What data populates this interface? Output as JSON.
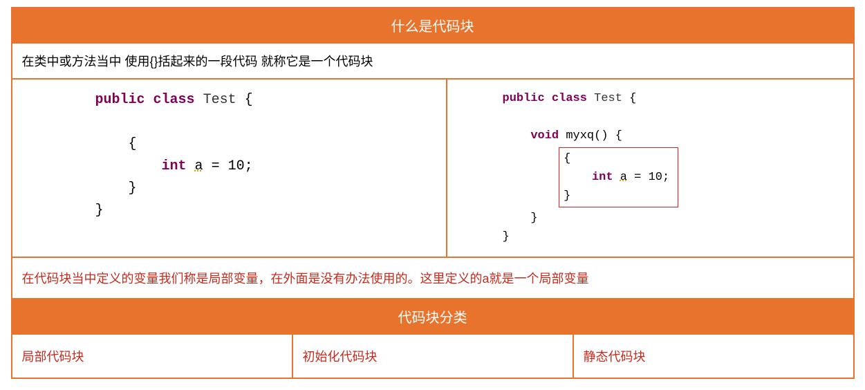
{
  "title": "什么是代码块",
  "definition": "在类中或方法当中 使用{}括起来的一段代码    就称它是一个代码块",
  "code_left": {
    "kw_public": "public",
    "kw_class": "class",
    "class_name": "Test",
    "open": "{",
    "block_open": "{",
    "kw_int": "int",
    "var": "a",
    "eq": "=",
    "val": "10;",
    "block_close": "}",
    "close": "}"
  },
  "code_right": {
    "kw_public": "public",
    "kw_class": "class",
    "class_name": "Test",
    "open": "{",
    "kw_void": "void",
    "method": "myxq()",
    "method_open": "{",
    "block_open": "{",
    "kw_int": "int",
    "var": "a",
    "eq": "=",
    "val": "10;",
    "block_close": "}",
    "method_close": "}",
    "close": "}"
  },
  "note": "在代码块当中定义的变量我们称是局部变量，在外面是没有办法使用的。这里定义的a就是一个局部变量",
  "types_title": "代码块分类",
  "types": {
    "t1": "局部代码块",
    "t2": "初始化代码块",
    "t3": "静态代码块"
  }
}
